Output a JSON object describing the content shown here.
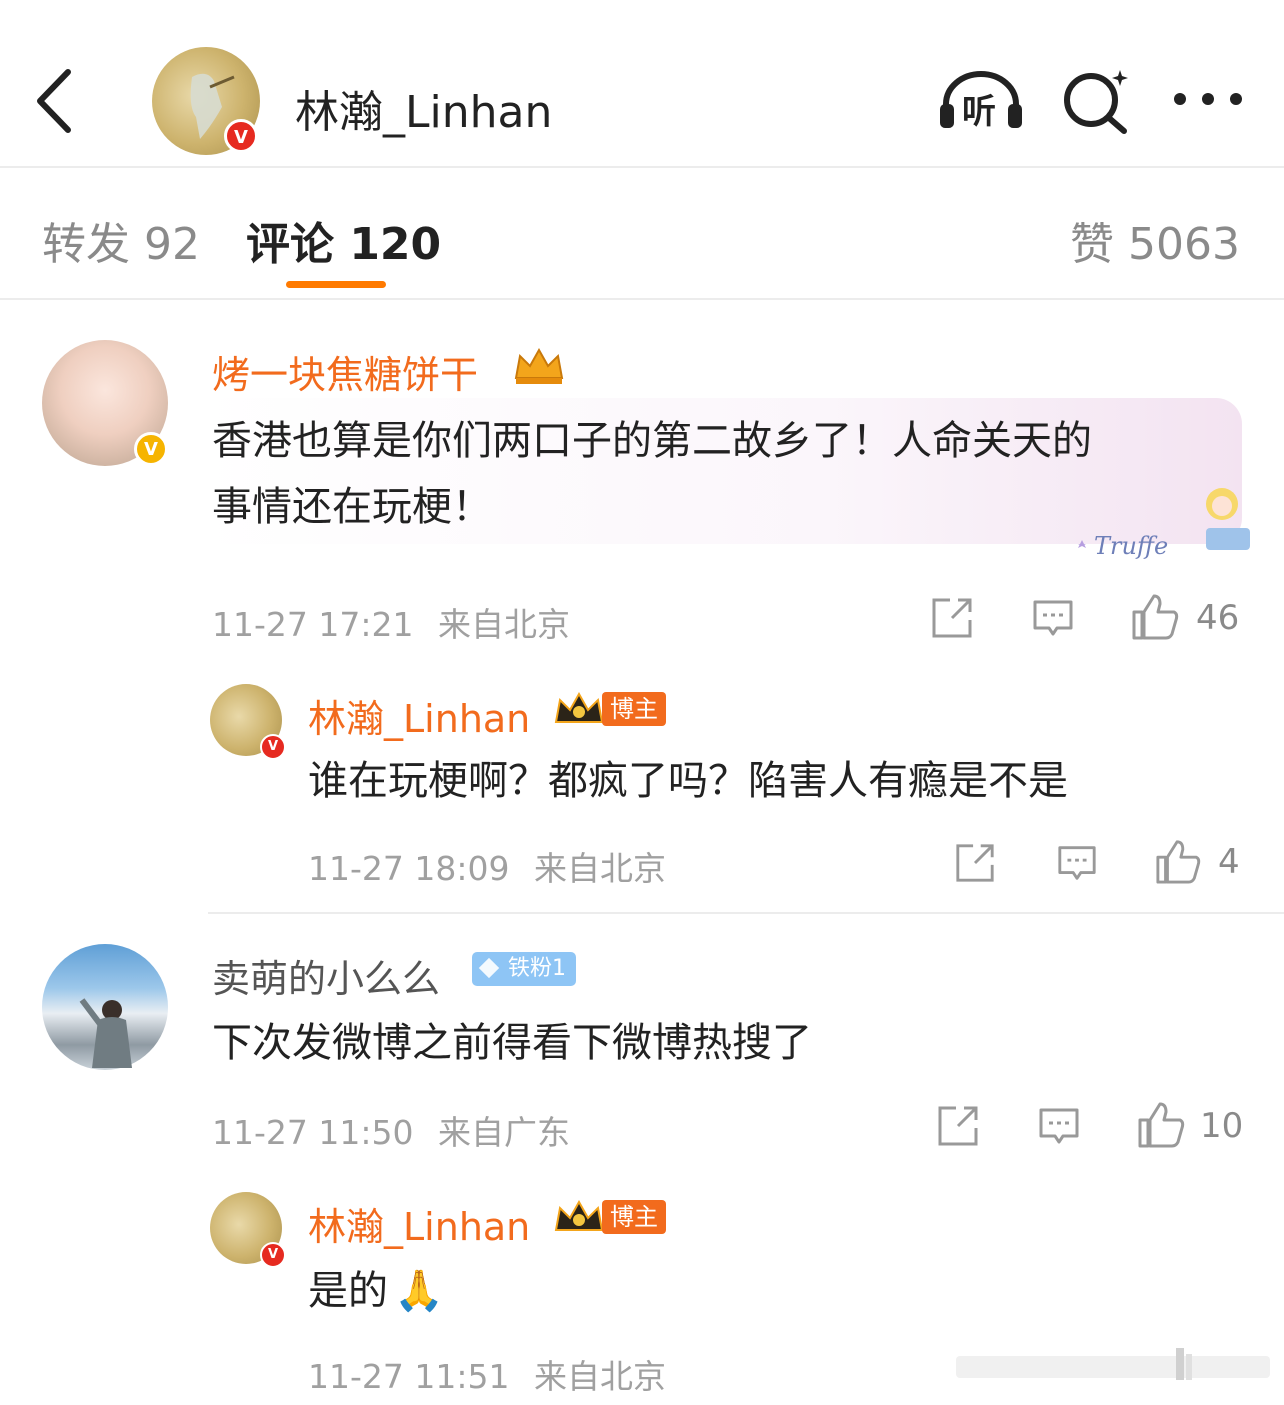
{
  "header": {
    "title": "林瀚_Linhan",
    "listen_label": "听"
  },
  "tabs": {
    "reposts": "转发 92",
    "comments": "评论 120",
    "likes": "赞 5063"
  },
  "comments": [
    {
      "username": "烤一块焦糖饼干",
      "text_line1": "香港也算是你们两口子的第二故乡了！人命关天的",
      "text_line2": "事情还在玩梗！",
      "time": "11-27 17:21",
      "location": "来自北京",
      "likes": "46",
      "sticker_text": "Truffe",
      "reply": {
        "username": "林瀚_Linhan",
        "badge": "博主",
        "text": "谁在玩梗啊？都疯了吗？陷害人有瘾是不是",
        "time": "11-27 18:09",
        "location": "来自北京",
        "likes": "4"
      }
    },
    {
      "username": "卖萌的小么么",
      "fan_badge": "铁粉1",
      "text": "下次发微博之前得看下微博热搜了",
      "time": "11-27 11:50",
      "location": "来自广东",
      "likes": "10",
      "reply": {
        "username": "林瀚_Linhan",
        "badge": "博主",
        "text": "是的",
        "emoji": "🙏",
        "time": "11-27 11:51",
        "location": "来自北京"
      }
    }
  ],
  "colors": {
    "accent": "#ff7a00",
    "username_highlight": "#f26b1d",
    "verified_red": "#e62a20",
    "verified_yellow": "#f6b400"
  }
}
